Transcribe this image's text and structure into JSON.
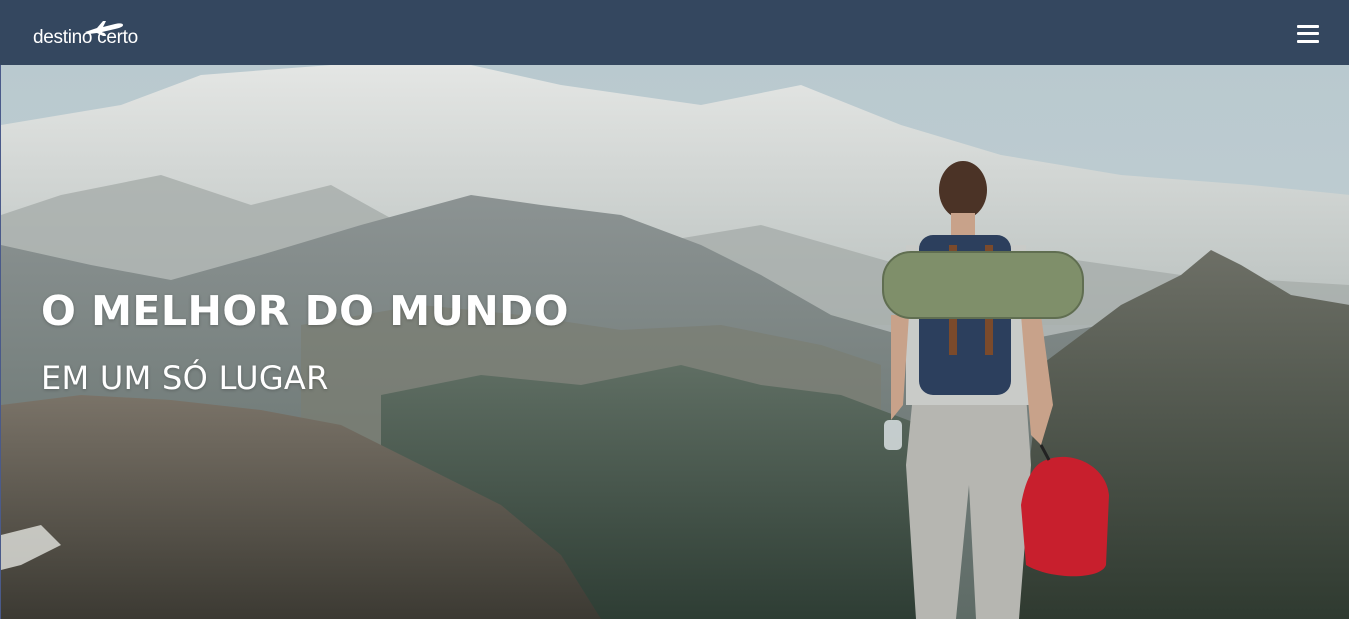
{
  "brand": {
    "logo_text": "destino certo",
    "logo_icon": "airplane-icon"
  },
  "nav": {
    "menu_icon": "hamburger-menu-icon"
  },
  "hero": {
    "headline": "O MELHOR DO MUNDO",
    "subheadline": "EM UM SÓ LUGAR",
    "background_image": "hiker-with-backpack-overlooking-mountains"
  },
  "colors": {
    "navbar": "#34475f",
    "text": "#ffffff"
  }
}
